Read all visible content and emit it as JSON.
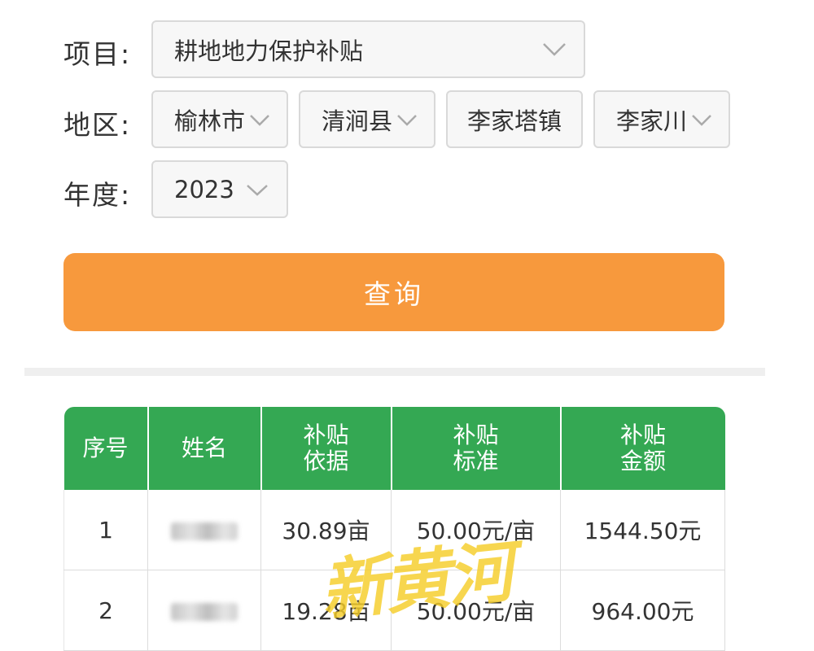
{
  "form": {
    "project": {
      "label": "项目:",
      "value": "耕地地力保护补贴"
    },
    "region": {
      "label": "地区:",
      "city": "榆林市",
      "county": "清涧县",
      "town": "李家塔镇",
      "village": "李家川"
    },
    "year": {
      "label": "年度:",
      "value": "2023"
    }
  },
  "query_button": {
    "label": "查询"
  },
  "table": {
    "headers": {
      "index": "序号",
      "name": "姓名",
      "basis": [
        "补贴",
        "依据"
      ],
      "standard": [
        "补贴",
        "标准"
      ],
      "amount": [
        "补贴",
        "金额"
      ]
    },
    "rows": [
      {
        "index": "1",
        "basis": "30.89亩",
        "standard": "50.00元/亩",
        "amount": "1544.50元"
      },
      {
        "index": "2",
        "basis": "19.28亩",
        "standard": "50.00元/亩",
        "amount": "964.00元"
      }
    ]
  },
  "watermark": "新黄河",
  "colors": {
    "accent": "#f7993d",
    "table_header": "#34a853",
    "watermark": "#f5cd28"
  },
  "icons": {
    "dropdown": "chevron-down-icon",
    "name_redaction": "blurred-name"
  }
}
